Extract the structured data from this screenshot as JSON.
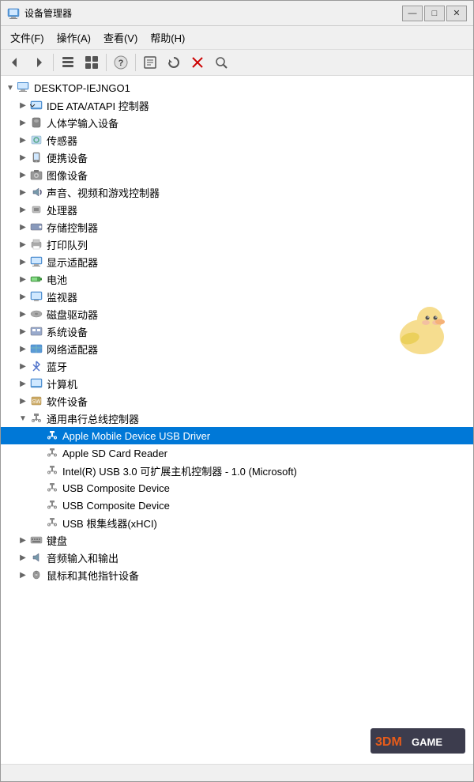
{
  "window": {
    "title": "设备管理器",
    "minimize_label": "—",
    "maximize_label": "□",
    "close_label": "✕"
  },
  "menu": {
    "items": [
      {
        "label": "文件(F)"
      },
      {
        "label": "操作(A)"
      },
      {
        "label": "查看(V)"
      },
      {
        "label": "帮助(H)"
      }
    ]
  },
  "toolbar": {
    "buttons": [
      {
        "name": "back",
        "icon": "◀"
      },
      {
        "name": "forward",
        "icon": "▶"
      },
      {
        "name": "tree-view",
        "icon": "⊟"
      },
      {
        "name": "list-view",
        "icon": "☰"
      },
      {
        "name": "help",
        "icon": "?"
      },
      {
        "name": "prop",
        "icon": "◫"
      },
      {
        "name": "update",
        "icon": "⟳"
      },
      {
        "name": "uninstall",
        "icon": "✖"
      },
      {
        "name": "scan",
        "icon": "🔍"
      },
      {
        "name": "properties2",
        "icon": "⚙"
      }
    ]
  },
  "tree": {
    "root": {
      "label": "DESKTOP-IEJNGO1",
      "expanded": true,
      "children": [
        {
          "label": "IDE ATA/ATAPI 控制器",
          "expanded": false,
          "type": "category"
        },
        {
          "label": "人体学输入设备",
          "expanded": false,
          "type": "category"
        },
        {
          "label": "传感器",
          "expanded": false,
          "type": "category"
        },
        {
          "label": "便携设备",
          "expanded": false,
          "type": "category"
        },
        {
          "label": "图像设备",
          "expanded": false,
          "type": "category"
        },
        {
          "label": "声音、视频和游戏控制器",
          "expanded": false,
          "type": "category"
        },
        {
          "label": "处理器",
          "expanded": false,
          "type": "category"
        },
        {
          "label": "存储控制器",
          "expanded": false,
          "type": "category"
        },
        {
          "label": "打印队列",
          "expanded": false,
          "type": "category"
        },
        {
          "label": "显示适配器",
          "expanded": false,
          "type": "category"
        },
        {
          "label": "电池",
          "expanded": false,
          "type": "category"
        },
        {
          "label": "监视器",
          "expanded": false,
          "type": "category"
        },
        {
          "label": "磁盘驱动器",
          "expanded": false,
          "type": "category"
        },
        {
          "label": "系统设备",
          "expanded": false,
          "type": "category"
        },
        {
          "label": "网络适配器",
          "expanded": false,
          "type": "category"
        },
        {
          "label": "蓝牙",
          "expanded": false,
          "type": "category"
        },
        {
          "label": "计算机",
          "expanded": false,
          "type": "category"
        },
        {
          "label": "软件设备",
          "expanded": false,
          "type": "category"
        },
        {
          "label": "通用串行总线控制器",
          "expanded": true,
          "type": "category",
          "children": [
            {
              "label": "Apple Mobile Device USB Driver",
              "selected": true,
              "type": "device"
            },
            {
              "label": "Apple SD Card Reader",
              "type": "device"
            },
            {
              "label": "Intel(R) USB 3.0 可扩展主机控制器 - 1.0 (Microsoft)",
              "type": "device"
            },
            {
              "label": "USB Composite Device",
              "type": "device"
            },
            {
              "label": "USB Composite Device",
              "type": "device"
            },
            {
              "label": "USB 根集线器(xHCI)",
              "type": "device"
            }
          ]
        },
        {
          "label": "键盘",
          "expanded": false,
          "type": "category"
        },
        {
          "label": "音频输入和输出",
          "expanded": false,
          "type": "category"
        },
        {
          "label": "鼠标和其他指针设备",
          "expanded": false,
          "type": "category"
        }
      ]
    }
  },
  "colors": {
    "selected_bg": "#0078d7",
    "hover_bg": "#cce8ff",
    "accent": "#0078d7"
  }
}
